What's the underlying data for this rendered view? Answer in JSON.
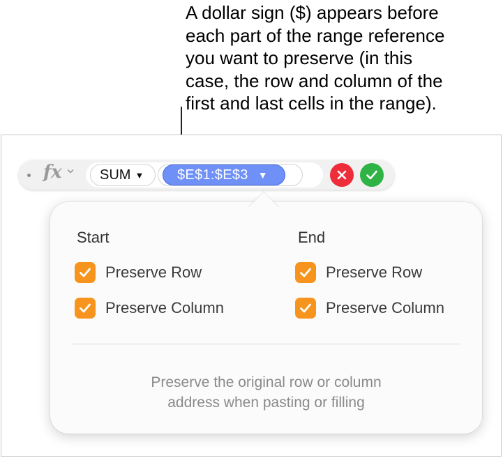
{
  "callout": {
    "text": "A dollar sign ($) appears before\neach part of the range reference\nyou want to preserve (in this\ncase, the row and column of the\nfirst and last cells in the range)."
  },
  "formula_bar": {
    "fx_label": "fx",
    "function_name": "SUM",
    "range_reference": "$E$1:$E$3",
    "dropdown_glyph": "▼"
  },
  "popover": {
    "start": {
      "title": "Start",
      "options": [
        {
          "label": "Preserve Row",
          "checked": true
        },
        {
          "label": "Preserve Column",
          "checked": true
        }
      ]
    },
    "end": {
      "title": "End",
      "options": [
        {
          "label": "Preserve Row",
          "checked": true
        },
        {
          "label": "Preserve Column",
          "checked": true
        }
      ]
    },
    "hint": "Preserve the original row or column\naddress when pasting or filling"
  },
  "colors": {
    "range_pill": "#6f90f7",
    "checkbox": "#f7941d",
    "cancel": "#ee2d3b",
    "accept": "#2fb344"
  },
  "icons": [
    "fx-icon",
    "chevron-down-icon",
    "dropdown-triangle-icon",
    "close-icon",
    "checkmark-icon"
  ]
}
